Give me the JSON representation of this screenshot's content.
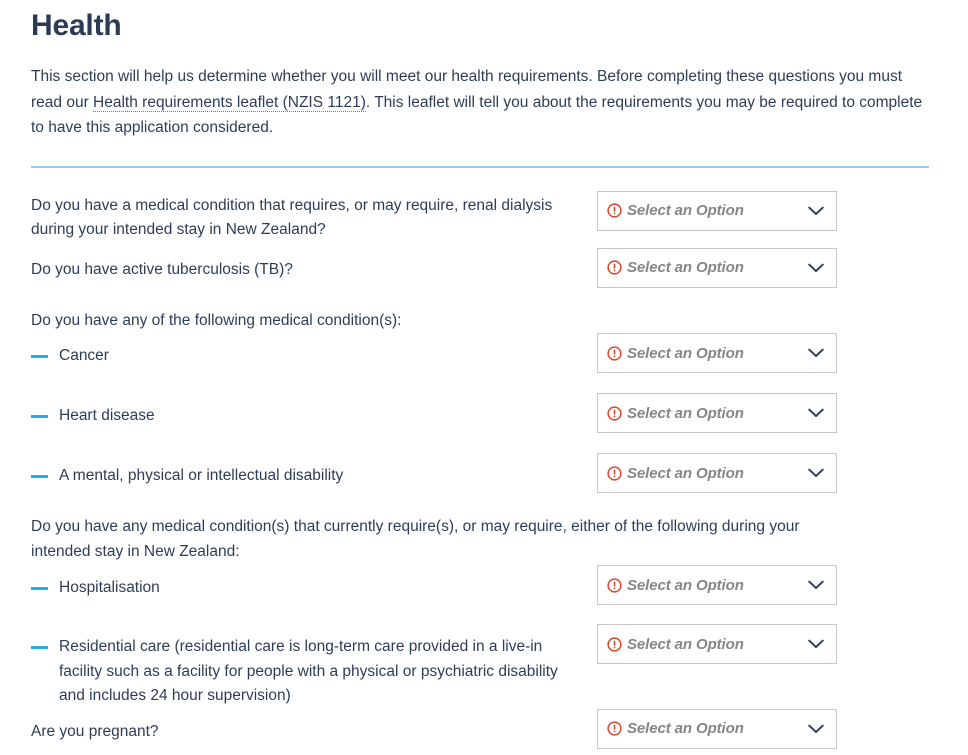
{
  "page": {
    "title": "Health",
    "intro": {
      "before_link": "This section will help us determine whether you will meet our health requirements. Before completing these questions you must read our ",
      "link_text": "Health requirements leaflet (NZIS 1121)",
      "after_link": ". This leaflet will tell you about the requirements you may be required to complete to have this application considered."
    }
  },
  "select": {
    "placeholder": "Select an Option",
    "warning_icon": "exclamation-circle-icon",
    "chevron_icon": "chevron-down-icon"
  },
  "colors": {
    "heading": "#2d3a53",
    "body_text": "#2e3d56",
    "divider": "#9ecbe8",
    "bullet_dash": "#29abe2",
    "warning": "#d8452b",
    "placeholder_text": "#868686",
    "field_border": "#c7c7c7",
    "chevron": "#2e3d56"
  },
  "questions": [
    {
      "id": "renal-dialysis",
      "type": "question",
      "text": "Do you have a medical condition that requires, or may require, renal dialysis during your intended stay in New Zealand?",
      "has_field": true
    },
    {
      "id": "active-tuberculosis",
      "type": "question",
      "text": "Do you have active tuberculosis (TB)?",
      "has_field": true
    },
    {
      "id": "following-conditions-heading",
      "type": "heading",
      "text": "Do you have any of the following medical condition(s):",
      "has_field": false
    },
    {
      "id": "cancer",
      "type": "bullet",
      "text": "Cancer",
      "has_field": true
    },
    {
      "id": "heart-disease",
      "type": "bullet",
      "text": "Heart disease",
      "has_field": true
    },
    {
      "id": "mental-physical-intellectual-disability",
      "type": "bullet",
      "text": "A mental, physical or intellectual disability",
      "has_field": true
    },
    {
      "id": "current-conditions-heading",
      "type": "heading",
      "text": "Do you have any medical condition(s) that currently require(s), or may require, either of the following during your intended stay in New Zealand:",
      "has_field": false
    },
    {
      "id": "hospitalisation",
      "type": "bullet",
      "text": "Hospitalisation",
      "has_field": true
    },
    {
      "id": "residential-care",
      "type": "bullet",
      "text": "Residential care (residential care is long-term care provided in a live-in facility such as a facility for people with a physical or psychiatric disability and includes 24 hour supervision)",
      "has_field": true
    },
    {
      "id": "pregnant",
      "type": "question",
      "text": "Are you pregnant?",
      "has_field": true
    }
  ]
}
